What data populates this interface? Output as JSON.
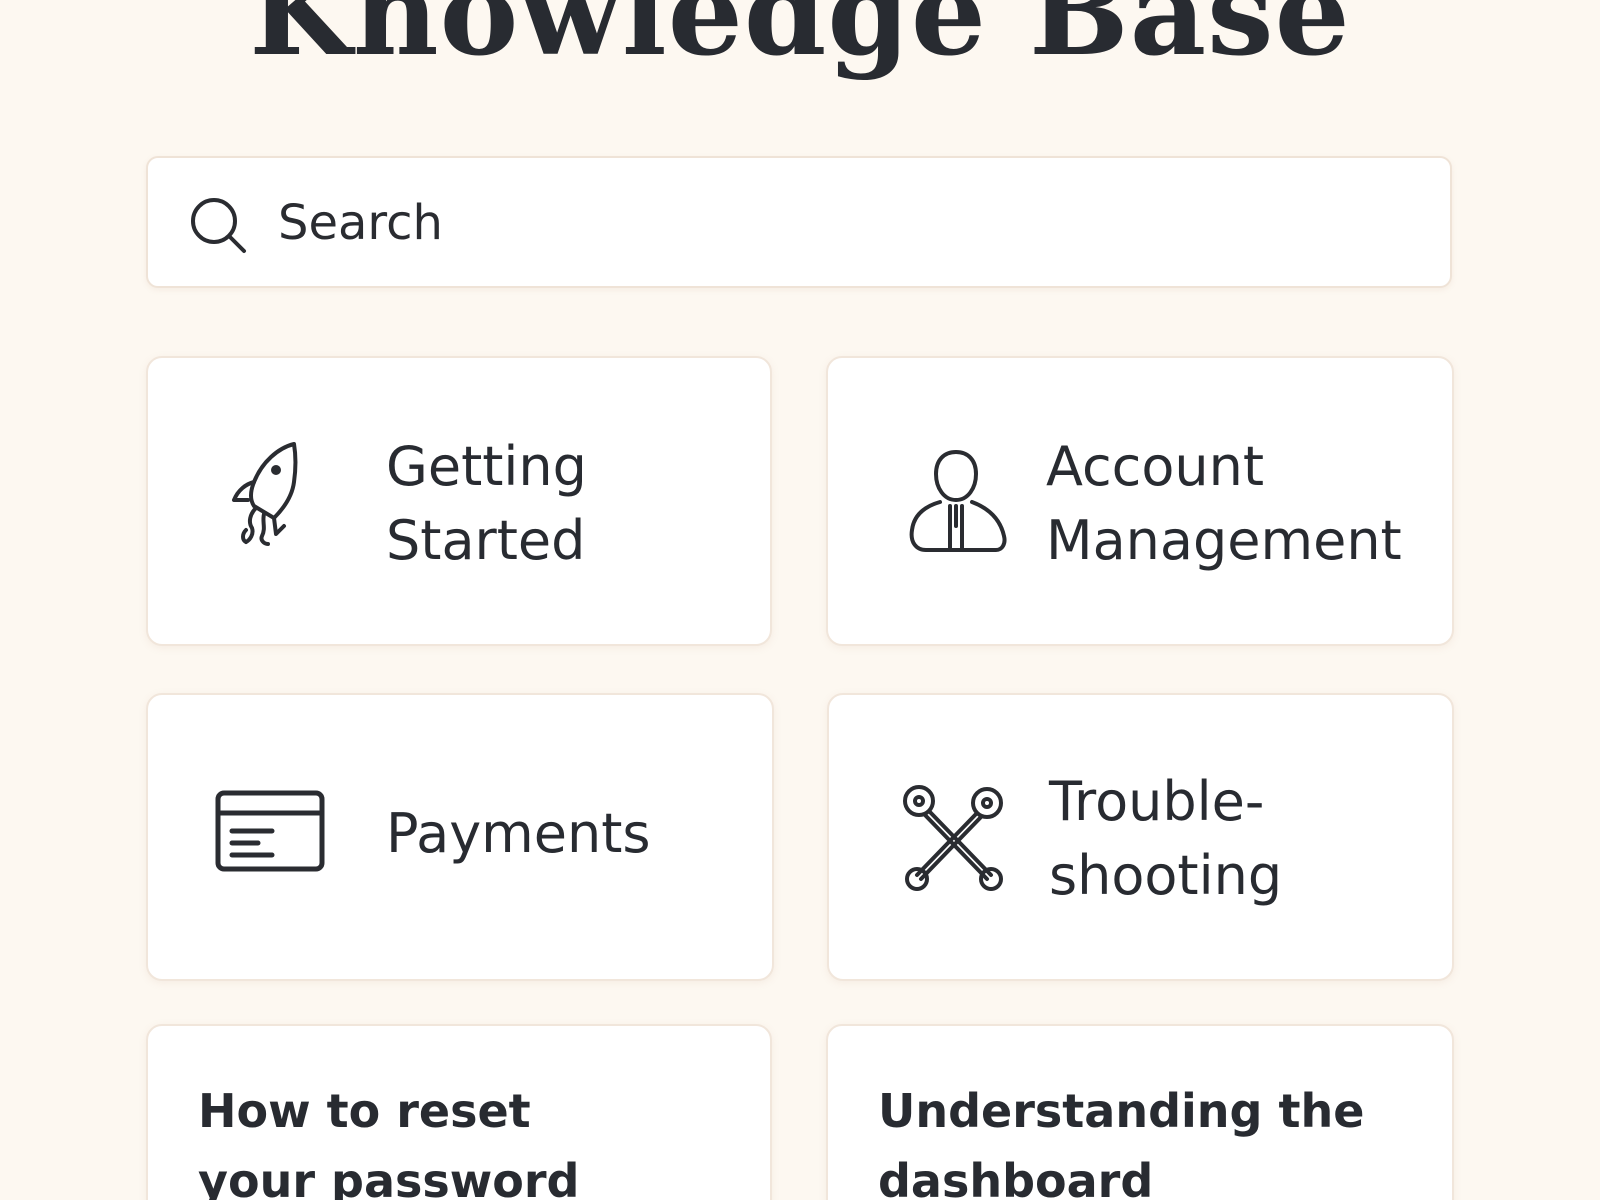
{
  "page_title": "Knowledge Base",
  "search": {
    "placeholder": "Search"
  },
  "categories": [
    {
      "icon": "rocket-icon",
      "line1": "Getting",
      "line2": "Started"
    },
    {
      "icon": "user-icon",
      "line1": "Account",
      "line2": "Management"
    },
    {
      "icon": "credit-card-icon",
      "line1": "Payments",
      "line2": ""
    },
    {
      "icon": "tools-icon",
      "line1": "Trouble-",
      "line2": "shooting"
    }
  ],
  "articles": [
    {
      "line1": "How to reset",
      "line2": "your password"
    },
    {
      "line1": "Understanding the",
      "line2": "dashboard"
    }
  ],
  "colors": {
    "background": "#fdf8f1",
    "card": "#ffffff",
    "border": "#f1e6db",
    "text": "#282b31"
  }
}
